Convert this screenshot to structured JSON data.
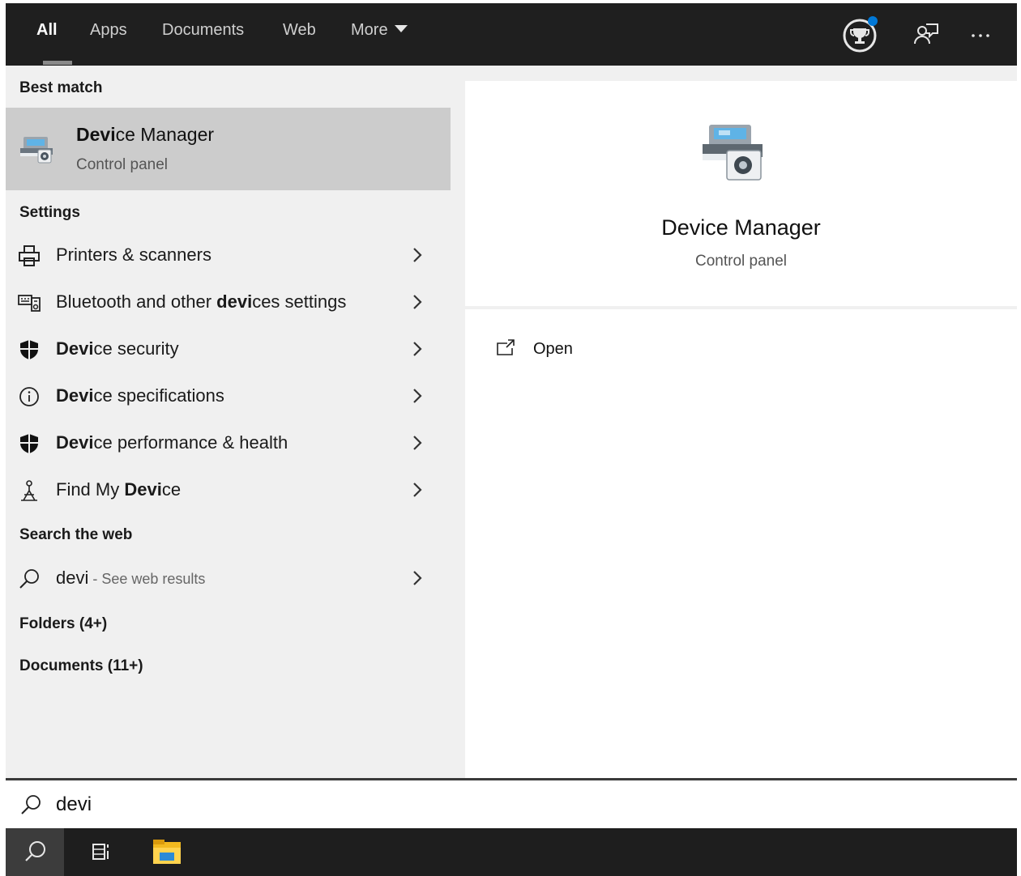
{
  "nav": {
    "tabs": [
      {
        "label": "All",
        "active": true
      },
      {
        "label": "Apps"
      },
      {
        "label": "Documents"
      },
      {
        "label": "Web"
      },
      {
        "label": "More"
      }
    ],
    "icons": [
      "rewards-trophy-icon",
      "feedback-icon",
      "more-options-icon"
    ]
  },
  "left": {
    "best_match_header": "Best match",
    "best_match": {
      "title_bold": "Devi",
      "title_rest": "ce Manager",
      "subtitle": "Control panel",
      "icon": "device-manager-icon"
    },
    "settings_header": "Settings",
    "settings": [
      {
        "icon": "printer-icon",
        "pre": "Printers & scanners",
        "bold": "",
        "post": ""
      },
      {
        "icon": "devices-icon",
        "pre": "Bluetooth and other ",
        "bold": "devi",
        "post": "ces settings"
      },
      {
        "icon": "shield-icon",
        "pre": "",
        "bold": "Devi",
        "post": "ce security"
      },
      {
        "icon": "info-icon",
        "pre": "",
        "bold": "Devi",
        "post": "ce specifications"
      },
      {
        "icon": "shield-icon",
        "pre": "",
        "bold": "Devi",
        "post": "ce performance & health"
      },
      {
        "icon": "find-device-icon",
        "pre": "Find My ",
        "bold": "Devi",
        "post": "ce"
      }
    ],
    "web_header": "Search the web",
    "web_result": {
      "query": "devi",
      "suffix": " - See web results"
    },
    "folders": "Folders (4+)",
    "documents": "Documents (11+)"
  },
  "preview": {
    "title": "Device Manager",
    "subtitle": "Control panel",
    "action_open": "Open"
  },
  "search": {
    "value": "devi"
  },
  "taskbar": {
    "icons": [
      "search-icon",
      "task-view-icon",
      "file-explorer-icon"
    ]
  },
  "colors": {
    "topbar": "#1f1f1f",
    "selected": "#cccccc",
    "accent": "#0078d7",
    "pane": "#f0f0f0"
  }
}
